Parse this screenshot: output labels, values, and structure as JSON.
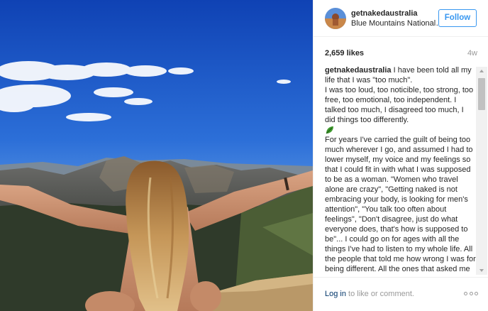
{
  "photo": {
    "icon": "landscape-photo-woman-mountains"
  },
  "header": {
    "avatar_icon": "profile-avatar",
    "username": "getnakedaustralia",
    "location": "Blue Mountains National Park",
    "follow_label": "Follow"
  },
  "stats": {
    "likes": "2,659 likes",
    "age": "4w"
  },
  "caption": {
    "username": "getnakedaustralia",
    "intro": "I have been told all my life that I was \"too much\".",
    "p1": "I was too loud, too noticible, too strong, too free, too emotional, too independent. I talked too much, I disagreed too much, I did things too differently.",
    "emoji_icon": "leaf-icon",
    "p2": "For years I've carried the guilt of being too much wherever I go, and assumed I had to lower myself, my voice and my feelings so that I could fit in with what I was supposed to be as a woman. \"Women who travel alone are crazy\", \"Getting naked is not embracing your body, is looking for men's attention\", \"You talk too often about feelings\", \"Don't disagree, just do what everyone does, that's how is supposed to be\"... I could go on for ages with all the things I've had to listen to my whole life. All the people that told me how wrong I was for being different. All the ones that asked me to"
  },
  "footer": {
    "login_link": "Log in",
    "login_rest": " to like or comment.",
    "more_icon": "more-options-icon"
  },
  "colors": {
    "accent_blue": "#3897f0",
    "link_dark_blue": "#003569",
    "muted_gray": "#999999",
    "text": "#262626"
  }
}
